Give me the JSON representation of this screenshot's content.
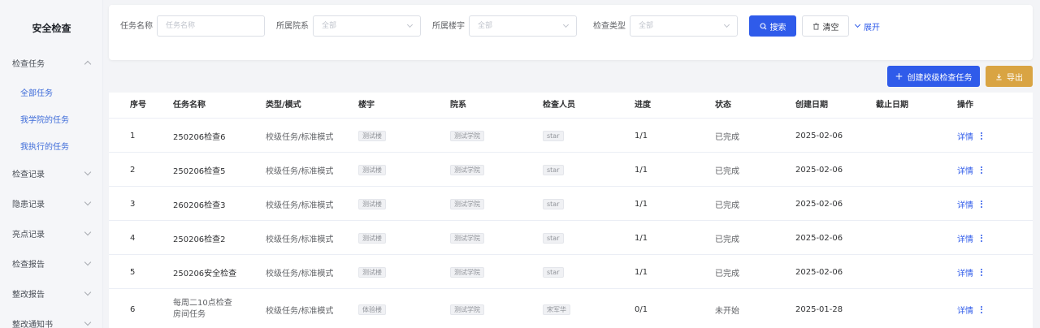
{
  "sidebar": {
    "title": "安全检查",
    "groups": [
      {
        "label": "检查任务",
        "expanded": true,
        "items": [
          "全部任务",
          "我学院的任务",
          "我执行的任务"
        ]
      },
      {
        "label": "检查记录",
        "expanded": false
      },
      {
        "label": "隐患记录",
        "expanded": false
      },
      {
        "label": "亮点记录",
        "expanded": false
      },
      {
        "label": "检查报告",
        "expanded": false
      },
      {
        "label": "整改报告",
        "expanded": false
      },
      {
        "label": "整改通知书",
        "expanded": false
      }
    ]
  },
  "filters": {
    "task_name": {
      "label": "任务名称",
      "placeholder": "任务名称"
    },
    "college": {
      "label": "所属院系",
      "value": "全部"
    },
    "building": {
      "label": "所属楼宇",
      "value": "全部"
    },
    "check_type": {
      "label": "检查类型",
      "value": "全部"
    },
    "search_label": "搜索",
    "clear_label": "清空",
    "expand_label": "展开"
  },
  "actions": {
    "create_label": "创建校级检查任务",
    "export_label": "导出"
  },
  "colors": {
    "primary": "#2f5bea",
    "export": "#d9a443"
  },
  "table": {
    "columns": [
      "序号",
      "任务名称",
      "类型/模式",
      "楼宇",
      "院系",
      "检查人员",
      "进度",
      "状态",
      "创建日期",
      "截止日期",
      "操作"
    ],
    "rows": [
      {
        "index": "1",
        "name": "250206检查6",
        "type": "校级任务/标准模式",
        "building": "测试楼",
        "college": "测试学院",
        "inspector": "star",
        "progress": "1/1",
        "status": "已完成",
        "created": "2025-02-06",
        "deadline": "",
        "action": "详情"
      },
      {
        "index": "2",
        "name": "250206检查5",
        "type": "校级任务/标准模式",
        "building": "测试楼",
        "college": "测试学院",
        "inspector": "star",
        "progress": "1/1",
        "status": "已完成",
        "created": "2025-02-06",
        "deadline": "",
        "action": "详情"
      },
      {
        "index": "3",
        "name": "260206检查3",
        "type": "校级任务/标准模式",
        "building": "测试楼",
        "college": "测试学院",
        "inspector": "star",
        "progress": "1/1",
        "status": "已完成",
        "created": "2025-02-06",
        "deadline": "",
        "action": "详情"
      },
      {
        "index": "4",
        "name": "250206检查2",
        "type": "校级任务/标准模式",
        "building": "测试楼",
        "college": "测试学院",
        "inspector": "star",
        "progress": "1/1",
        "status": "已完成",
        "created": "2025-02-06",
        "deadline": "",
        "action": "详情"
      },
      {
        "index": "5",
        "name": "250206安全检查",
        "type": "校级任务/标准模式",
        "building": "测试楼",
        "college": "测试学院",
        "inspector": "star",
        "progress": "1/1",
        "status": "已完成",
        "created": "2025-02-06",
        "deadline": "",
        "action": "详情"
      },
      {
        "index": "6",
        "name": "每周二10点检查房间任务",
        "type": "校级任务/标准模式",
        "building": "体验楼",
        "college": "测试学院",
        "inspector": "宋军华",
        "progress": "0/1",
        "status": "未开始",
        "created": "2025-01-28",
        "deadline": "",
        "action": "详情"
      }
    ]
  }
}
